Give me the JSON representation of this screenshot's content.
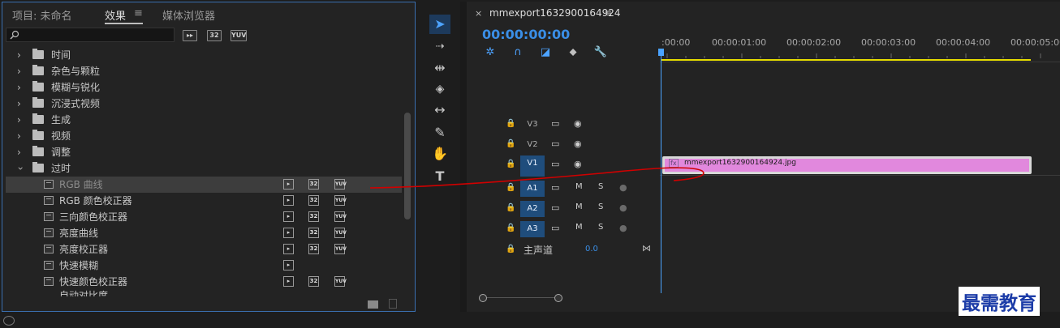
{
  "panel_tabs": {
    "project": "项目: 未命名",
    "effects": "效果",
    "effects_menu": "≡",
    "media": "媒体浏览器"
  },
  "search": {
    "placeholder": ""
  },
  "accel_badges": [
    "32",
    "YUV"
  ],
  "tree_folders": [
    "时间",
    "杂色与颗粒",
    "模糊与锐化",
    "沉浸式视频",
    "生成",
    "视频",
    "调整"
  ],
  "expanded_folder": "过时",
  "effects_items": [
    {
      "label": "RGB 曲线",
      "badge32": "32",
      "yuv": "YUV"
    },
    {
      "label": "RGB 颜色校正器",
      "badge32": "32",
      "yuv": "YUV"
    },
    {
      "label": "三向颜色校正器",
      "badge32": "32",
      "yuv": "YUV"
    },
    {
      "label": "亮度曲线",
      "badge32": "32",
      "yuv": "YUV"
    },
    {
      "label": "亮度校正器",
      "badge32": "32",
      "yuv": "YUV"
    },
    {
      "label": "快速模糊",
      "badge32": "",
      "yuv": ""
    },
    {
      "label": "快速颜色校正器",
      "badge32": "32",
      "yuv": "YUV"
    },
    {
      "label": "自动对比度",
      "badge32": "",
      "yuv": ""
    }
  ],
  "timeline": {
    "close": "×",
    "sequence_name": "mmexport1632900164924",
    "menu": "≡",
    "timecode": "00:00:00:00",
    "ruler": [
      ":00:00",
      "00:00:01:00",
      "00:00:02:00",
      "00:00:03:00",
      "00:00:04:00",
      "00:00:05:00"
    ],
    "video_tracks": [
      "V3",
      "V2",
      "V1"
    ],
    "audio_tracks": [
      "A1",
      "A2",
      "A3"
    ],
    "mute": "M",
    "solo": "S",
    "master_label": "主声道",
    "master_value": "0.0",
    "clip_fx": "fx",
    "clip_name": "mmexport1632900164924.jpg"
  },
  "colors": {
    "accent": "#3a8ee6",
    "clip": "#e188dd",
    "track_highlight": "#1f4d7c",
    "playhead": "#4aa3ff",
    "workarea": "#e6dc00",
    "annotation": "#d10000"
  },
  "watermark": "最需教育"
}
